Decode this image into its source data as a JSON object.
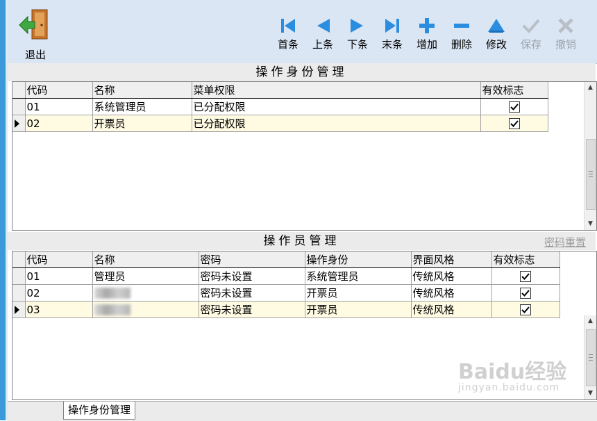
{
  "toolbar": {
    "exit_label": "退出",
    "buttons": [
      {
        "label": "首条",
        "icon": "first-record-icon",
        "enabled": true
      },
      {
        "label": "上条",
        "icon": "prev-record-icon",
        "enabled": true
      },
      {
        "label": "下条",
        "icon": "next-record-icon",
        "enabled": true
      },
      {
        "label": "末条",
        "icon": "last-record-icon",
        "enabled": true
      },
      {
        "label": "增加",
        "icon": "add-icon",
        "enabled": true
      },
      {
        "label": "删除",
        "icon": "delete-icon",
        "enabled": true
      },
      {
        "label": "修改",
        "icon": "edit-icon",
        "enabled": true
      },
      {
        "label": "保存",
        "icon": "save-icon",
        "enabled": false
      },
      {
        "label": "撤销",
        "icon": "undo-icon",
        "enabled": false
      }
    ]
  },
  "roles_panel": {
    "title": "操作身份管理",
    "columns": [
      "代码",
      "名称",
      "菜单权限",
      "有效标志"
    ],
    "rows": [
      {
        "code": "01",
        "name": "系统管理员",
        "perm": "已分配权限",
        "valid": true,
        "current": false
      },
      {
        "code": "02",
        "name": "开票员",
        "perm": "已分配权限",
        "valid": true,
        "current": true
      }
    ]
  },
  "operators_panel": {
    "title": "操作员管理",
    "reset_link": "密码重置",
    "columns": [
      "代码",
      "名称",
      "密码",
      "操作身份",
      "界面风格",
      "有效标志"
    ],
    "rows": [
      {
        "code": "01",
        "name": "管理员",
        "password": "密码未设置",
        "role": "系统管理员",
        "style": "传统风格",
        "valid": true,
        "current": false,
        "blurred": false
      },
      {
        "code": "02",
        "name": "",
        "password": "密码未设置",
        "role": "开票员",
        "style": "传统风格",
        "valid": true,
        "current": false,
        "blurred": true
      },
      {
        "code": "03",
        "name": "",
        "password": "密码未设置",
        "role": "开票员",
        "style": "传统风格",
        "valid": true,
        "current": true,
        "blurred": true
      }
    ]
  },
  "bottom_tab": "操作身份管理",
  "watermark": {
    "text": "Baidu经验",
    "sub": "jingyan.baidu.com"
  },
  "colors": {
    "toolbar_bg": "#dbe6f4",
    "icon_blue": "#2a8de0",
    "current_row": "#fffbe3",
    "disabled": "#9aa3ad"
  }
}
